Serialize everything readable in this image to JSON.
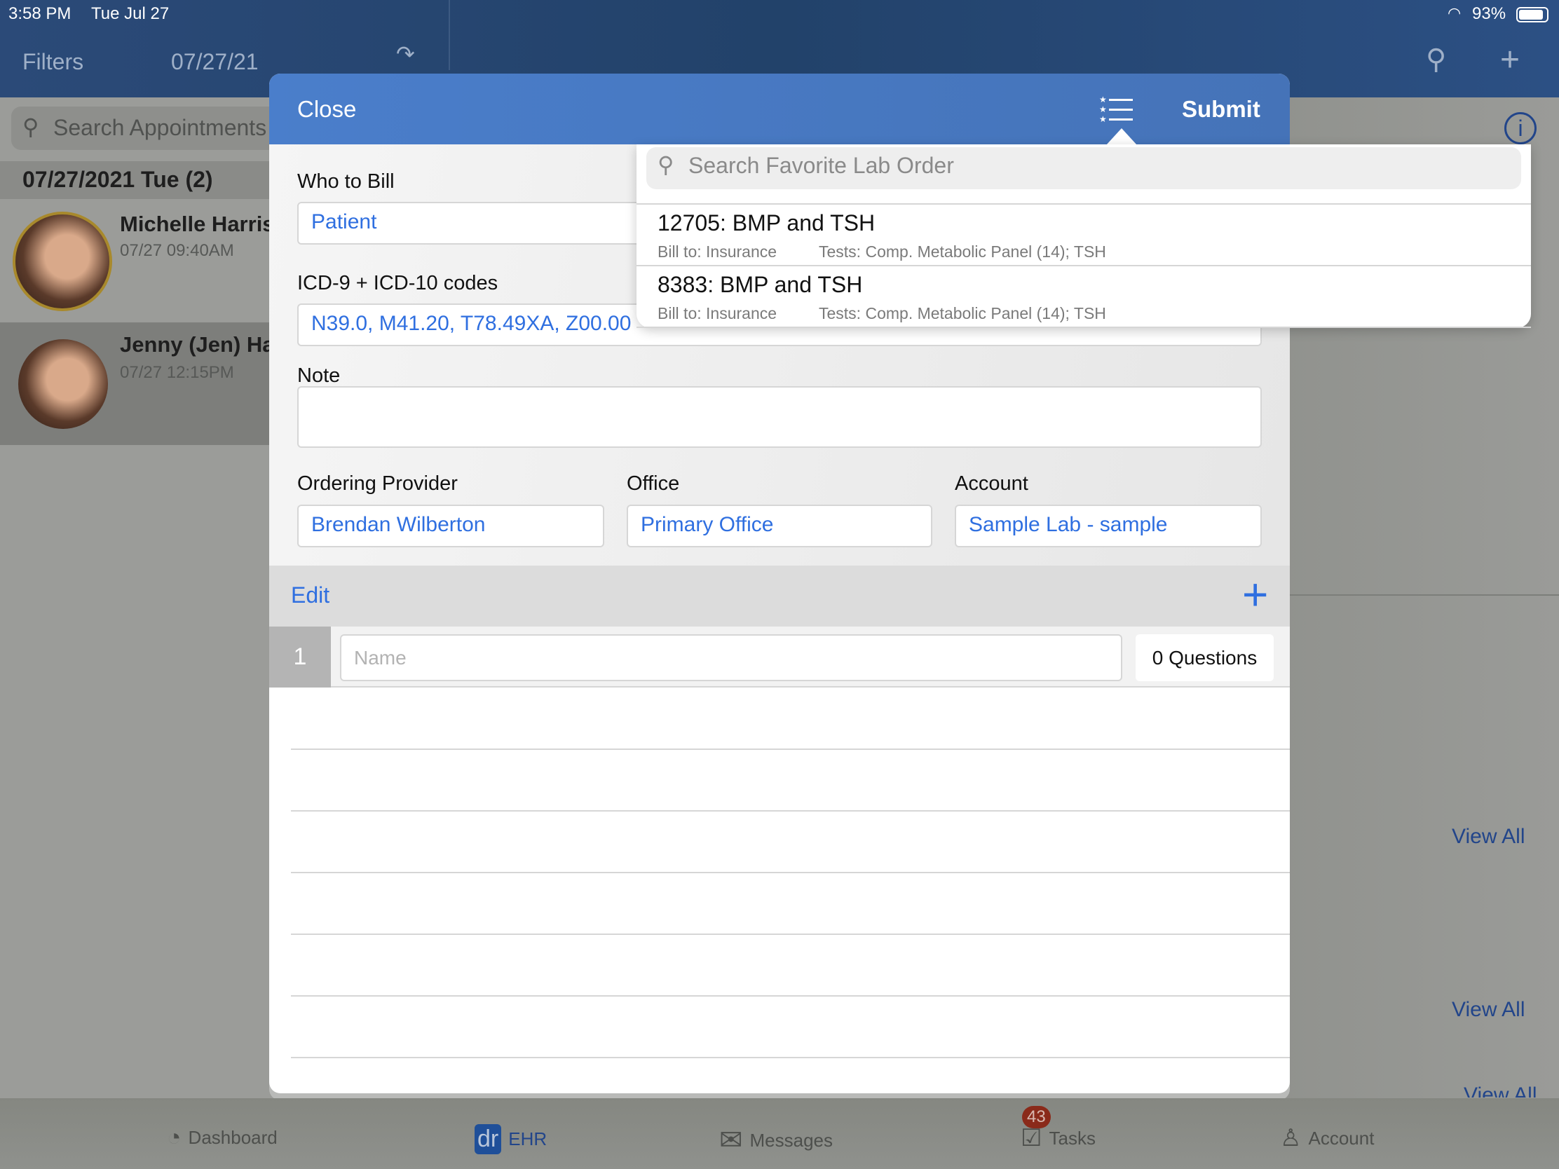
{
  "status_bar": {
    "time": "3:58 PM",
    "date": "Tue Jul 27",
    "battery": "93%"
  },
  "background": {
    "filters_label": "Filters",
    "date_picker": "07/27/21",
    "search_placeholder": "Search Appointments",
    "date_header": "07/27/2021 Tue (2)",
    "appointments": [
      {
        "name": "Michelle Harris",
        "time": "07/27 09:40AM"
      },
      {
        "name": "Jenny (Jen) Ha",
        "time": "07/27 12:15PM"
      }
    ],
    "view_all": [
      "View All",
      "View All",
      "View All"
    ]
  },
  "modal": {
    "close_label": "Close",
    "submit_label": "Submit",
    "who_to_bill_label": "Who to Bill",
    "who_to_bill_value": "Patient",
    "icd_label": "ICD-9 + ICD-10 codes",
    "icd_value": "N39.0, M41.20, T78.49XA, Z00.00",
    "note_label": "Note",
    "note_value": "",
    "ordering_provider_label": "Ordering Provider",
    "ordering_provider_value": "Brendan Wilberton",
    "office_label": "Office",
    "office_value": "Primary Office",
    "account_label": "Account",
    "account_value": "Sample Lab - sample",
    "edit_label": "Edit",
    "rows": [
      {
        "number": "1",
        "name_placeholder": "Name",
        "questions": "0 Questions"
      }
    ]
  },
  "favorites_popup": {
    "search_placeholder": "Search Favorite Lab Order",
    "items": [
      {
        "title": "12705: BMP and TSH",
        "bill_to": "Bill to: Insurance",
        "tests": "Tests: Comp. Metabolic Panel (14); TSH"
      },
      {
        "title": "8383: BMP and TSH",
        "bill_to": "Bill to: Insurance",
        "tests": "Tests: Comp. Metabolic Panel (14); TSH"
      }
    ]
  },
  "tab_bar": {
    "items": [
      {
        "label": "Dashboard",
        "icon": "gauge-icon"
      },
      {
        "label": "EHR",
        "icon": "dr-logo-icon",
        "active": true
      },
      {
        "label": "Messages",
        "icon": "envelope-icon"
      },
      {
        "label": "Tasks",
        "icon": "checklist-icon",
        "badge": "43"
      },
      {
        "label": "Account",
        "icon": "person-icon"
      }
    ]
  },
  "colors": {
    "accent": "#2f6fe0",
    "header": "#4a7ecb",
    "badge": "#8a2a1a"
  }
}
